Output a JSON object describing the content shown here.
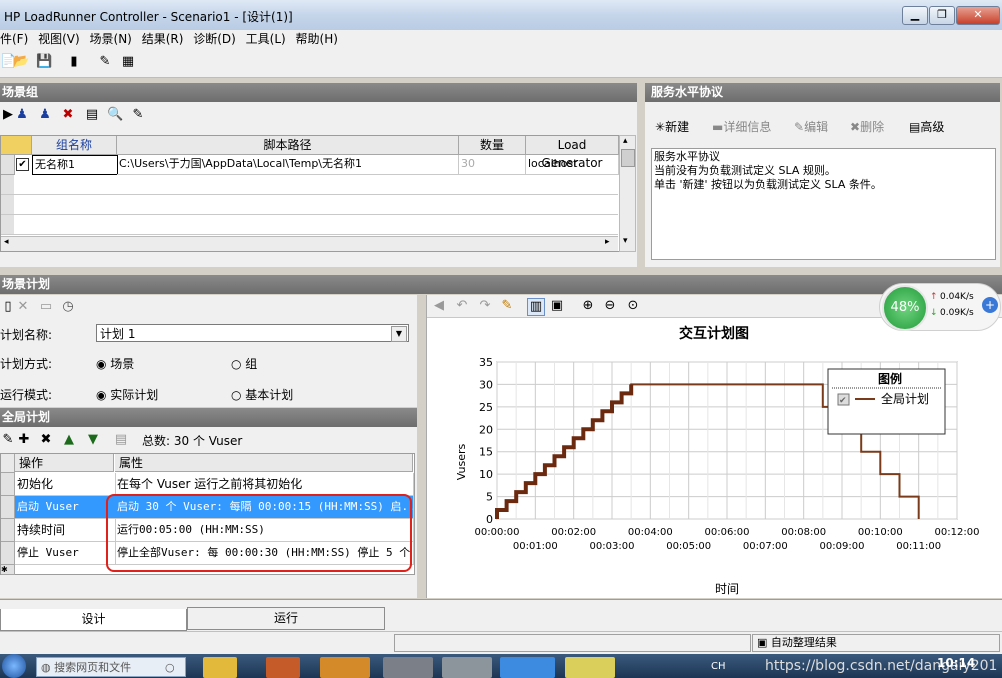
{
  "window": {
    "title": "HP LoadRunner Controller - Scenario1 - [设计(1)]"
  },
  "menu": [
    "件(F)",
    "视图(V)",
    "场景(N)",
    "结果(R)",
    "诊断(D)",
    "工具(L)",
    "帮助(H)"
  ],
  "scenario_groups": {
    "title": "场景组",
    "columns": [
      "组名称",
      "脚本路径",
      "数量",
      "Load Generator"
    ],
    "rows": [
      {
        "name": "无名称1",
        "path": "C:\\Users\\于力国\\AppData\\Local\\Temp\\无名称1",
        "qty": "30",
        "lg": "localhost",
        "checked": true
      }
    ]
  },
  "sla": {
    "title": "服务水平协议",
    "new": "新建",
    "details": "详细信息",
    "edit": "编辑",
    "delete": "删除",
    "advanced": "高级",
    "box_title": "服务水平协议",
    "line1": "当前没有为负载测试定义 SLA 规则。",
    "line2": "单击 '新建' 按钮以为负载测试定义 SLA 条件。"
  },
  "schedule": {
    "title": "场景计划",
    "name_label": "计划名称:",
    "name_value": "计划 1",
    "mode_label": "计划方式:",
    "mode_opt1": "场景",
    "mode_opt2": "组",
    "run_label": "运行模式:",
    "run_opt1": "实际计划",
    "run_opt2": "基本计划"
  },
  "global_schedule": {
    "title": "全局计划",
    "total": "总数: 30 个 Vuser",
    "col_action": "操作",
    "col_props": "属性",
    "rows": [
      {
        "action": "初始化",
        "props": "在每个 Vuser 运行之前将其初始化"
      },
      {
        "action": "启动 Vuser",
        "props": "启动 30 个 Vuser: 每隔 00:00:15 (HH:MM:SS) 启..."
      },
      {
        "action": "持续时间",
        "props": "运行00:05:00 (HH:MM:SS)"
      },
      {
        "action": "停止 Vuser",
        "props": "停止全部Vuser: 每 00:00:30 (HH:MM:SS) 停止 5 个"
      }
    ]
  },
  "network_widget": {
    "percent": "48%",
    "up": "0.04K/s",
    "down": "0.09K/s"
  },
  "chart_data": {
    "type": "line",
    "title": "交互计划图",
    "xlabel": "时间",
    "ylabel": "Vusers",
    "ylim": [
      0,
      35
    ],
    "yticks": [
      "0",
      "5",
      "10",
      "15",
      "20",
      "25",
      "30",
      "35"
    ],
    "xticks_top": [
      "00:00:00",
      "00:02:00",
      "00:04:00",
      "00:06:00",
      "00:08:00",
      "00:10:00",
      "00:12:00"
    ],
    "xticks_bottom": [
      "00:01:00",
      "00:03:00",
      "00:05:00",
      "00:07:00",
      "00:09:00",
      "00:11:00"
    ],
    "xlim_seconds": [
      0,
      720
    ],
    "grid": true,
    "legend": {
      "title": "图例",
      "placement": "top-right"
    },
    "series": [
      {
        "name": "全局计划",
        "color": "#7a3b1a",
        "points_seconds": [
          [
            0,
            0
          ],
          [
            0,
            2
          ],
          [
            15,
            2
          ],
          [
            15,
            4
          ],
          [
            30,
            4
          ],
          [
            30,
            6
          ],
          [
            45,
            6
          ],
          [
            45,
            8
          ],
          [
            60,
            8
          ],
          [
            60,
            10
          ],
          [
            75,
            10
          ],
          [
            75,
            12
          ],
          [
            90,
            12
          ],
          [
            90,
            14
          ],
          [
            105,
            14
          ],
          [
            105,
            16
          ],
          [
            120,
            16
          ],
          [
            120,
            18
          ],
          [
            135,
            18
          ],
          [
            135,
            20
          ],
          [
            150,
            20
          ],
          [
            150,
            22
          ],
          [
            165,
            22
          ],
          [
            165,
            24
          ],
          [
            180,
            24
          ],
          [
            180,
            26
          ],
          [
            195,
            26
          ],
          [
            195,
            28
          ],
          [
            210,
            28
          ],
          [
            210,
            30
          ],
          [
            510,
            30
          ],
          [
            510,
            25
          ],
          [
            540,
            25
          ],
          [
            540,
            20
          ],
          [
            570,
            20
          ],
          [
            570,
            15
          ],
          [
            600,
            15
          ],
          [
            600,
            10
          ],
          [
            630,
            10
          ],
          [
            630,
            5
          ],
          [
            660,
            5
          ],
          [
            660,
            0
          ]
        ]
      }
    ]
  },
  "bottom_tabs": [
    "设计",
    "运行"
  ],
  "status": {
    "auto_collate": "自动整理结果"
  },
  "taskbar": {
    "search": "搜索网页和文件",
    "lang": "CH",
    "time": "10:14",
    "watermark": "https://blog.csdn.net/dangaiy201"
  }
}
